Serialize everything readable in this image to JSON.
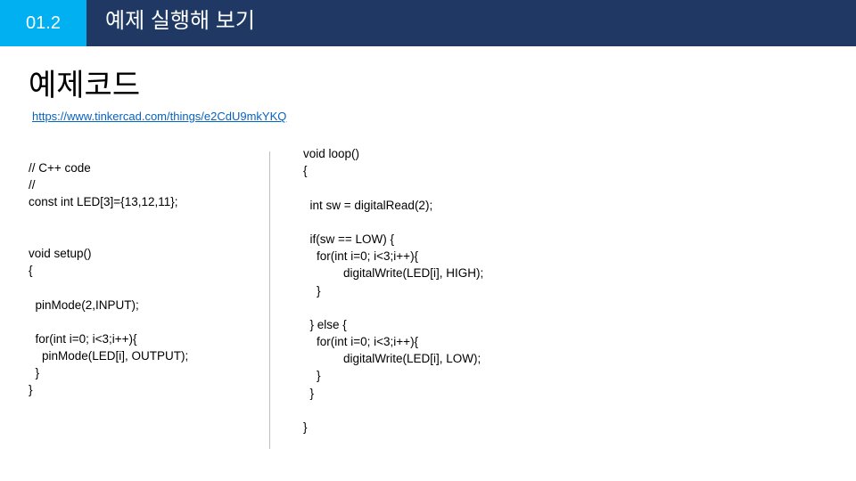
{
  "header": {
    "number": "01.2",
    "title": "예제 실행해 보기"
  },
  "slide": {
    "title": "예제코드",
    "link": "https://www.tinkercad.com/things/e2CdU9mkYKQ"
  },
  "code_left": [
    "// C++ code",
    "//",
    "const int LED[3]={13,12,11};",
    "",
    "",
    "void setup()",
    "{",
    "",
    "  pinMode(2,INPUT);",
    "",
    "  for(int i=0; i<3;i++){",
    "    pinMode(LED[i], OUTPUT);",
    "  }",
    "}"
  ],
  "code_right": [
    "void loop()",
    "{",
    "",
    "  int sw = digitalRead(2);",
    "",
    "  if(sw == LOW) {",
    "    for(int i=0; i<3;i++){",
    "            digitalWrite(LED[i], HIGH);",
    "    }",
    "",
    "  } else {",
    "    for(int i=0; i<3;i++){",
    "            digitalWrite(LED[i], LOW);",
    "    }",
    "  }",
    "",
    "}"
  ]
}
